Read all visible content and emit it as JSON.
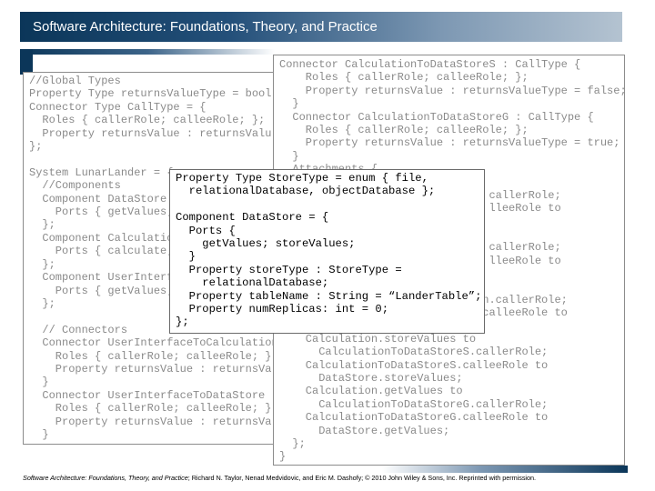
{
  "header": {
    "title": "Software Architecture: Foundations, Theory, and Practice"
  },
  "colors": {
    "title_bar": "#0b3659",
    "code_grey": "#8a8a8a",
    "code_black": "#000000"
  },
  "left_code": [
    "//Global Types",
    "Property Type returnsValueType = bool",
    "Connector Type CallType = {",
    "  Roles { callerRole; calleeRole; };",
    "  Property returnsValue : returnsValu",
    "};",
    "",
    "System LunarLander = {",
    "  //Components",
    "  Component DataStore",
    "    Ports { getValues;",
    "  };",
    "  Component Calculatio",
    "    Ports { calculate;",
    "  };",
    "  Component UserInterf",
    "    Ports { getValues;",
    "  };",
    "",
    "  // Connectors",
    "  Connector UserInterfaceToCalculation",
    "    Roles { callerRole; calleeRole; }",
    "    Property returnsValue : returnsVa",
    "  }",
    "  Connector UserInterfaceToDataStore",
    "    Roles { callerRole; calleeRole; }",
    "    Property returnsValue : returnsVa",
    "  }"
  ],
  "right_code": [
    "Connector CalculationToDataStoreS : CallType {",
    "    Roles { callerRole; calleeRole; };",
    "    Property returnsValue : returnsValueType = false;",
    "  }",
    "  Connector CalculationToDataStoreG : CallType {",
    "    Roles { callerRole; calleeRole; };",
    "    Property returnsValue : returnsValueType = true;",
    "  }",
    "  Attachments {",
    "",
    "                                callerRole;",
    "                                lleeRole to",
    "",
    "",
    "                                callerRole;",
    "                                lleeRole to",
    "",
    "",
    "                               n.callerRole;",
    "                               calleeRole to",
    "",
    "    Calculation.storeValues to",
    "      CalculationToDataStoreS.callerRole;",
    "    CalculationToDataStoreS.calleeRole to",
    "      DataStore.storeValues;",
    "    Calculation.getValues to",
    "      CalculationToDataStoreG.callerRole;",
    "    CalculationToDataStoreG.calleeRole to",
    "      DataStore.getValues;",
    "  };",
    "}"
  ],
  "mid_code": [
    "Property Type StoreType = enum { file,",
    "  relationalDatabase, objectDatabase };",
    "",
    "Component DataStore = {",
    "  Ports {",
    "    getValues; storeValues;",
    "  }",
    "  Property storeType : StoreType =",
    "    relationalDatabase;",
    "  Property tableName : String = “LanderTable”;",
    "  Property numReplicas: int = 0;",
    "};"
  ],
  "footer": {
    "book_title": "Software Architecture: Foundations, Theory, and Practice",
    "credit": "; Richard N. Taylor, Nenad Medvidovic, and Eric M. Dashofy; © 2010 John Wiley & Sons, Inc. Reprinted with permission."
  }
}
